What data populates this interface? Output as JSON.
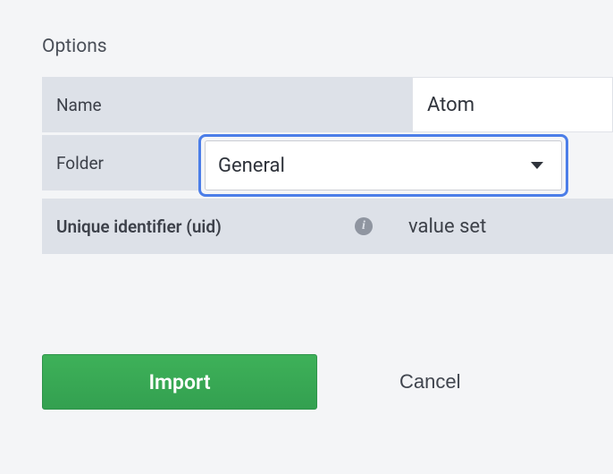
{
  "section_title": "Options",
  "rows": {
    "name": {
      "label": "Name",
      "value": "Atom"
    },
    "folder": {
      "label": "Folder",
      "value": "General"
    },
    "uid": {
      "label": "Unique identifier (uid)",
      "value": "value set"
    }
  },
  "buttons": {
    "import": "Import",
    "cancel": "Cancel"
  }
}
